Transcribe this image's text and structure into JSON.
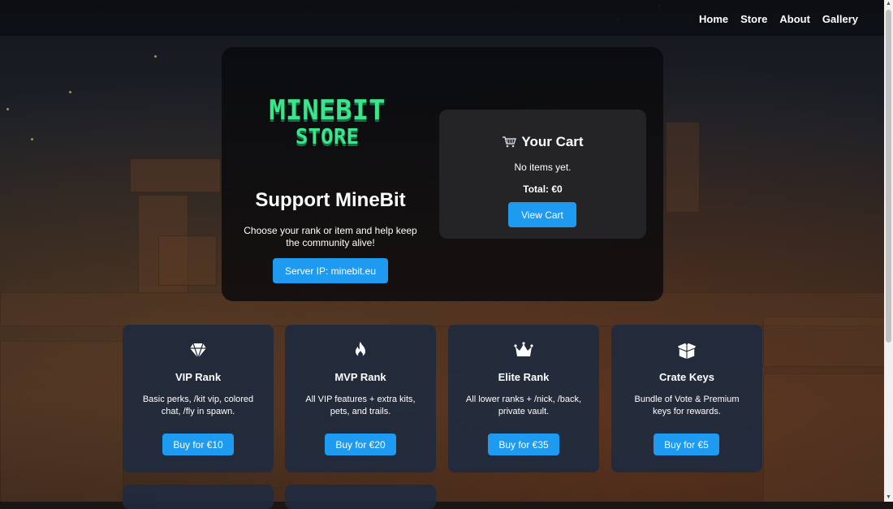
{
  "nav": {
    "items": [
      "Home",
      "Store",
      "About",
      "Gallery"
    ]
  },
  "hero": {
    "logo_alt": "MINEBIT STORE",
    "title": "Support MineBit",
    "subtitle": "Choose your rank or item and help keep the community alive!",
    "ip_button": "Server IP: minebit.eu"
  },
  "cart": {
    "icon": "cart-icon",
    "title": "Your Cart",
    "empty_text": "No items yet.",
    "total": "Total: €0",
    "button": "View Cart"
  },
  "products": [
    {
      "icon": "diamond-icon",
      "title": "VIP Rank",
      "description": "Basic perks, /kit vip, colored chat, /fly in spawn.",
      "button": "Buy for €10"
    },
    {
      "icon": "fire-icon",
      "title": "MVP Rank",
      "description": "All VIP features + extra kits, pets, and trails.",
      "button": "Buy for €20"
    },
    {
      "icon": "crown-icon",
      "title": "Elite Rank",
      "description": "All lower ranks + /nick, /back, private vault.",
      "button": "Buy for €35"
    },
    {
      "icon": "box-open-icon",
      "title": "Crate Keys",
      "description": "Bundle of Vote & Premium keys for rewards.",
      "button": "Buy for €5"
    }
  ],
  "colors": {
    "accent": "#1e9bf0",
    "logo_green": "#3be58c",
    "card_bg": "#202a3e"
  }
}
